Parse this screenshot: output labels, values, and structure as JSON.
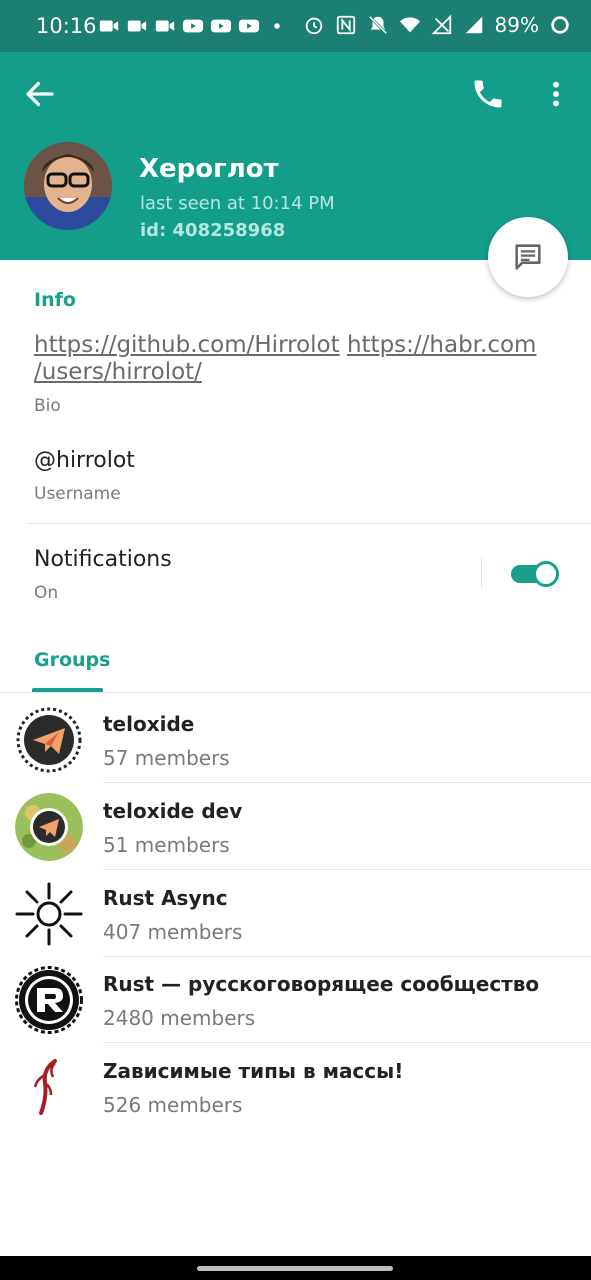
{
  "status_bar": {
    "time": "10:16",
    "battery": "89%"
  },
  "header": {
    "name": "Хероглот",
    "last_seen": "last seen at 10:14 PM",
    "id": "id: 408258968"
  },
  "info": {
    "title": "Info",
    "bio_link1": "https://github.com/Hirrolot",
    "bio_link2_line1": "https://habr.com",
    "bio_link2_line2": "/users/hirrolot/",
    "bio_label": "Bio",
    "username": "@hirrolot",
    "username_label": "Username",
    "notifications_label": "Notifications",
    "notifications_value": "On",
    "notifications_enabled": true
  },
  "groups": {
    "title": "Groups",
    "items": [
      {
        "name": "teloxide",
        "members": "57 members"
      },
      {
        "name": "teloxide dev",
        "members": "51 members"
      },
      {
        "name": "Rust Async",
        "members": "407 members"
      },
      {
        "name": "Rust — русскоговорящее сообщество",
        "members": "2480 members"
      },
      {
        "name": "Zависимые типы в массы!",
        "members": "526 members"
      }
    ]
  },
  "colors": {
    "accent": "#18a08c",
    "header_bg": "#139e8a",
    "status_bg": "#1b7f72"
  }
}
